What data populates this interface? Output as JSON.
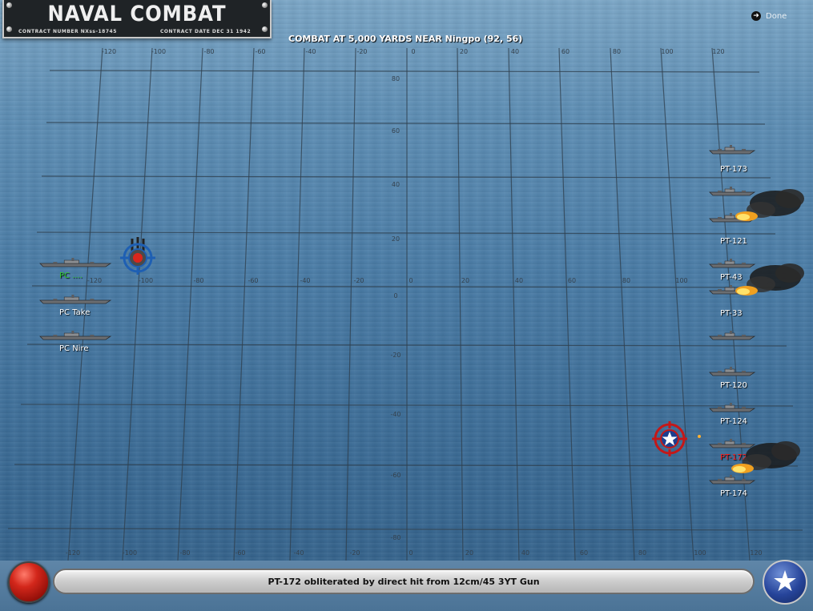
{
  "header": {
    "title": "NAVAL COMBAT",
    "contract_number": "CONTRACT NUMBER  NXss-18745",
    "contract_date": "CONTRACT DATE  DEC 31 1942"
  },
  "combat_title": "COMBAT AT 5,000 YARDS NEAR Ningpo (92, 56)",
  "done_label": "Done",
  "grid": {
    "top_axis_labels": [
      "-120",
      "-100",
      "-80",
      "-60",
      "-40",
      "-20",
      "0",
      "20",
      "40",
      "60",
      "80",
      "100",
      "120"
    ],
    "mid_axis_labels": [
      "-120",
      "-100",
      "-80",
      "-60",
      "-40",
      "-20",
      "0",
      "20",
      "40",
      "60",
      "80",
      "100"
    ],
    "bottom_axis_labels": [
      "-120",
      "-100",
      "-80",
      "-60",
      "-40",
      "-20",
      "0",
      "20",
      "40",
      "60",
      "80",
      "100",
      "120"
    ],
    "vertical_axis_labels": [
      "80",
      "60",
      "40",
      "20",
      "0",
      "-20",
      "-40",
      "-60",
      "-80"
    ]
  },
  "enemy_ships": [
    {
      "name": "PC ....",
      "color": "#33cc33"
    },
    {
      "name": "PC Take",
      "color": "#ffffff"
    },
    {
      "name": "PC Nire",
      "color": "#ffffff"
    }
  ],
  "allied_ships": [
    {
      "name": "PT-173",
      "color": "#ffffff"
    },
    {
      "name": "",
      "color": "#ffffff"
    },
    {
      "name": "PT-121",
      "color": "#ffffff"
    },
    {
      "name": "PT-43",
      "color": "#ffffff"
    },
    {
      "name": "PT-33",
      "color": "#ffffff"
    },
    {
      "name": "",
      "color": "#ffffff"
    },
    {
      "name": "PT-120",
      "color": "#ffffff"
    },
    {
      "name": "PT-124",
      "color": "#ffffff"
    },
    {
      "name": "PT-172",
      "color": "#ff2222"
    },
    {
      "name": "PT-174",
      "color": "#ffffff"
    }
  ],
  "status_message": "PT-172 obliterated by direct hit from 12cm/45 3YT Gun",
  "colors": {
    "sea": "#4a7ca6",
    "grid_line": "#2f3f4d",
    "enemy_target": "#1e5fb3",
    "allied_target": "#c41818",
    "selected_green": "#33cc33",
    "hit_red": "#ff2222"
  },
  "icons": {
    "done": "arrow-right-circle-icon",
    "end_turn": "red-ball-button",
    "us_star": "us-star-icon",
    "enemy_target": "crosshair-target-icon",
    "allied_target": "star-crosshair-icon"
  }
}
